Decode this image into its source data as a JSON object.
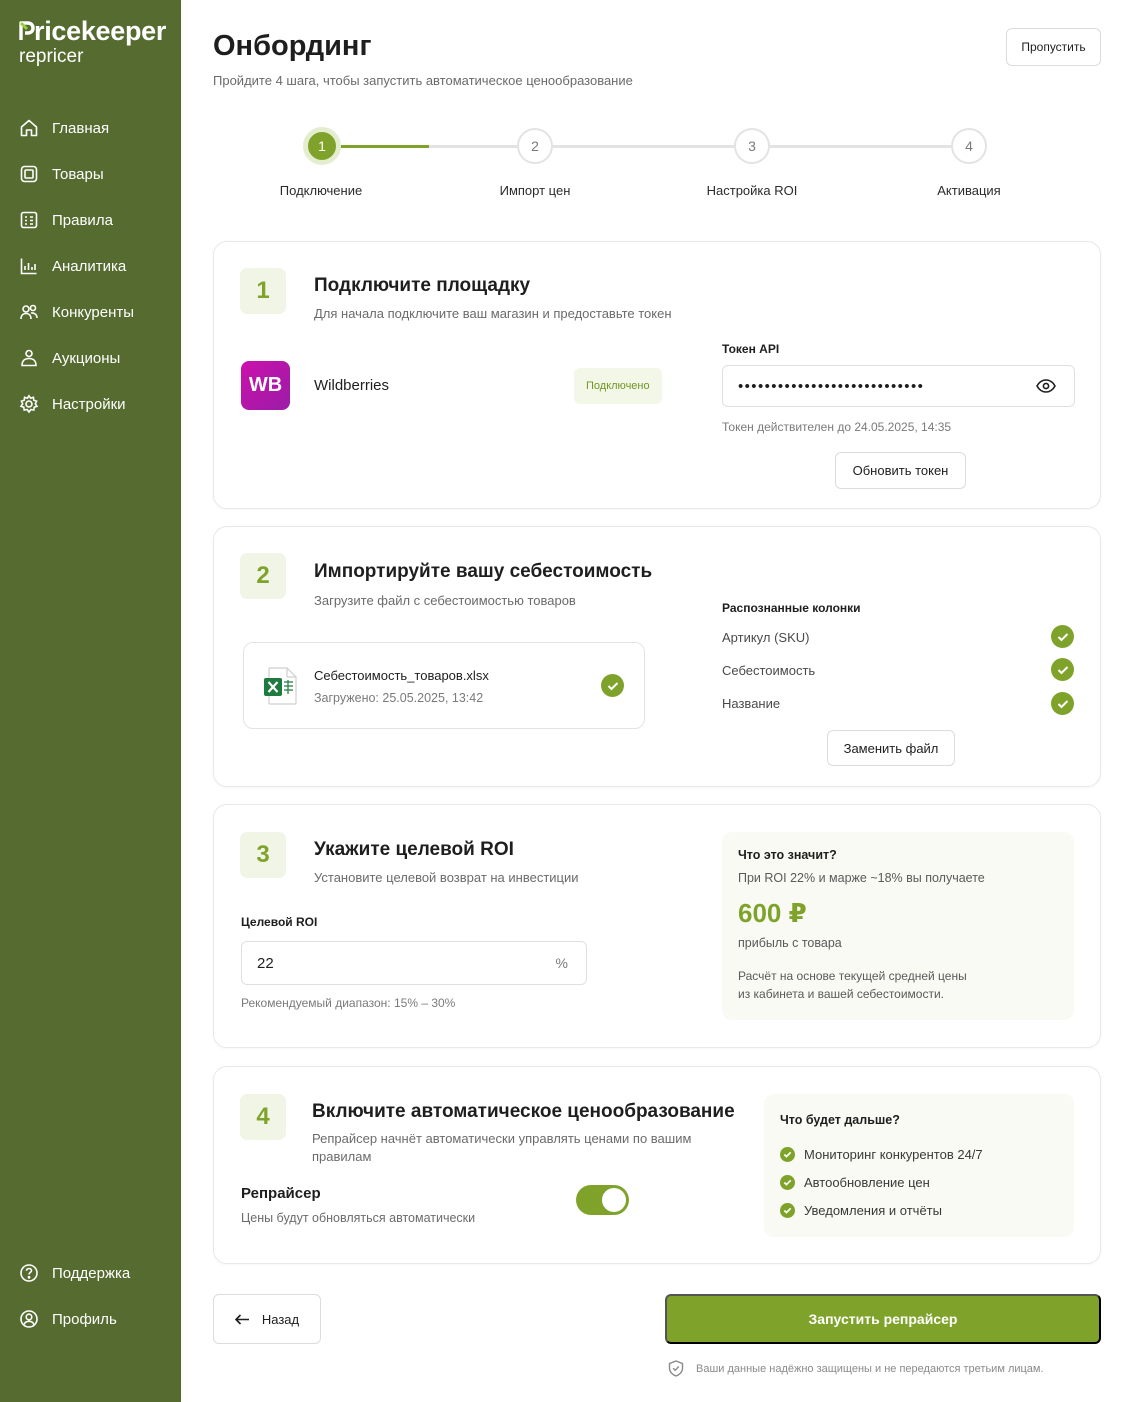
{
  "colors": {
    "sidebar": "#556b2f",
    "accent": "#7fa32a",
    "wb_brand": "#cb11ab"
  },
  "logo": {
    "main": "ricekeeper",
    "sub": "repricer"
  },
  "sidebar": {
    "items": [
      {
        "label": "Главная",
        "icon": "home-icon"
      },
      {
        "label": "Товары",
        "icon": "box-icon"
      },
      {
        "label": "Правила",
        "icon": "rules-icon"
      },
      {
        "label": "Аналитика",
        "icon": "chart-icon"
      },
      {
        "label": "Конкуренты",
        "icon": "competitors-icon"
      },
      {
        "label": "Аукционы",
        "icon": "auction-icon"
      },
      {
        "label": "Настройки",
        "icon": "gear-icon"
      }
    ],
    "bottom": [
      {
        "label": "Поддержка",
        "icon": "help-icon"
      },
      {
        "label": "Профиль",
        "icon": "profile-icon"
      }
    ]
  },
  "header": {
    "title": "Онбординг",
    "subtitle": "Пройдите 4 шага, чтобы запустить автоматическое ценообразование",
    "skip_label": "Пропустить"
  },
  "stepper": {
    "current": 1,
    "steps": [
      {
        "num": "1",
        "label": "Подключение"
      },
      {
        "num": "2",
        "label": "Импорт цен"
      },
      {
        "num": "3",
        "label": "Настройка ROI"
      },
      {
        "num": "4",
        "label": "Активация"
      }
    ]
  },
  "step1": {
    "num": "1",
    "title": "Подключите площадку",
    "subtitle": "Для начала подключите ваш магазин и предоставьте токен",
    "marketplace_logo": "WB",
    "marketplace_name": "Wildberries",
    "status": "Подключено",
    "token_label": "Токен API",
    "token_value": "••••••••••••••••••••••••••••",
    "token_valid": "Токен действителен до 24.05.2025, 14:35",
    "refresh_label": "Обновить токен"
  },
  "step2": {
    "num": "2",
    "title": "Импортируйте вашу себестоимость",
    "subtitle": "Загрузите файл с себестоимостью товаров",
    "file_name": "Себестоимость_товаров.xlsx",
    "file_uploaded": "Загружено: 25.05.2025, 13:42",
    "columns_label": "Распознанные колонки",
    "columns": [
      "Артикул (SKU)",
      "Себестоимость",
      "Название"
    ],
    "replace_label": "Заменить файл"
  },
  "step3": {
    "num": "3",
    "title": "Укажите целевой ROI",
    "subtitle": "Установите целевой возврат на инвестиции",
    "roi_label": "Целевой ROI",
    "roi_value": "22",
    "roi_unit": "%",
    "roi_hint": "Рекомендуемый диапазон: 15% – 30%",
    "info_title": "Что это значит?",
    "info_text": "При ROI 22% и марже ~18% вы получаете",
    "info_amount": "600 ₽",
    "info_amount_caption": "прибыль с товара",
    "info_note_1": "Расчёт на основе текущей средней цены",
    "info_note_2": "из кабинета и вашей себестоимости."
  },
  "step4": {
    "num": "4",
    "title": "Включите автоматическое ценообразование",
    "subtitle_1": "Репрайсер начнёт автоматически управлять ценами по вашим",
    "subtitle_2": "правилам",
    "toggle_label": "Репрайсер",
    "toggle_caption": "Цены будут обновляться автоматически",
    "toggle_on": true,
    "next_title": "Что будет дальше?",
    "next_items": [
      "Мониторинг конкурентов 24/7",
      "Автообновление цен",
      "Уведомления и отчёты"
    ]
  },
  "footer": {
    "back_label": "Назад",
    "launch_label": "Запустить репрайсер",
    "secure_note": "Ваши данные надёжно защищены и не передаются третьим лицам."
  }
}
